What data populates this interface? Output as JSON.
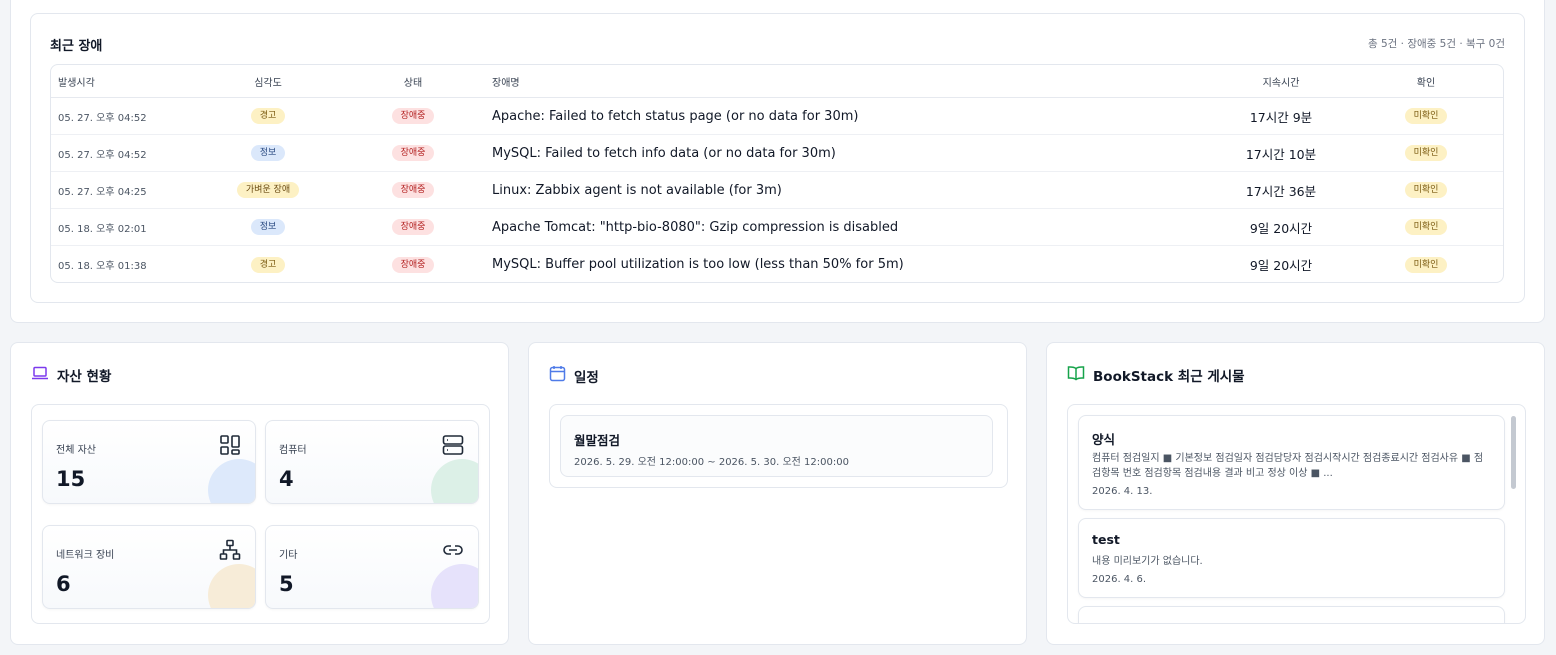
{
  "incidents": {
    "title": "최근 장애",
    "summary": "총 5건 · 장애중 5건 · 복구 0건",
    "headers": {
      "time": "발생시각",
      "severity": "심각도",
      "state": "상태",
      "name": "장애명",
      "duration": "지속시간",
      "ack": "확인"
    },
    "rows": [
      {
        "time": "05. 27. 오후 04:52",
        "severity": "경고",
        "state": "장애중",
        "name": "Apache: Failed to fetch status page (or no data for 30m)",
        "duration": "17시간 9분",
        "ack": "미확인"
      },
      {
        "time": "05. 27. 오후 04:52",
        "severity": "정보",
        "state": "장애중",
        "name": "MySQL: Failed to fetch info data (or no data for 30m)",
        "duration": "17시간 10분",
        "ack": "미확인"
      },
      {
        "time": "05. 27. 오후 04:25",
        "severity": "가벼운 장애",
        "state": "장애중",
        "name": "Linux: Zabbix agent is not available (for 3m)",
        "duration": "17시간 36분",
        "ack": "미확인"
      },
      {
        "time": "05. 18. 오후 02:01",
        "severity": "정보",
        "state": "장애중",
        "name": "Apache Tomcat: \"http-bio-8080\": Gzip compression is disabled",
        "duration": "9일 20시간",
        "ack": "미확인"
      },
      {
        "time": "05. 18. 오후 01:38",
        "severity": "경고",
        "state": "장애중",
        "name": "MySQL: Buffer pool utilization is too low (less than 50% for 5m)",
        "duration": "9일 20시간",
        "ack": "미확인"
      }
    ]
  },
  "assets": {
    "title": "자산 현황",
    "icon": "laptop-icon",
    "accent": "#7c3aed",
    "tiles": [
      {
        "label": "전체 자산",
        "count": "15",
        "icon": "grid-icon",
        "blob_color": "#dde9fb"
      },
      {
        "label": "컴퓨터",
        "count": "4",
        "icon": "server-icon",
        "blob_color": "#dcf0e7"
      },
      {
        "label": "네트워크 장비",
        "count": "6",
        "icon": "network-icon",
        "blob_color": "#f7ecd8"
      },
      {
        "label": "기타",
        "count": "5",
        "icon": "link-icon",
        "blob_color": "#e6e2fb"
      }
    ]
  },
  "schedule": {
    "title": "일정",
    "icon": "calendar-icon",
    "accent": "#4f7be8",
    "items": [
      {
        "title": "월말점검",
        "period": "2026. 5. 29. 오전 12:00:00 ~ 2026. 5. 30. 오전 12:00:00"
      }
    ]
  },
  "bookstack": {
    "title": "BookStack 최근 게시물",
    "icon": "book-open-icon",
    "accent": "#16a34a",
    "posts": [
      {
        "title": "양식",
        "preview": "컴퓨터 점검일지 ■ 기본정보 점검일자 점검담당자 점검시작시간 점검종료시간 점검사유 ■ 점검항목 번호 점검항목 점검내용 결과 비고 정상 이상 ■ ...",
        "date": "2026. 4. 13."
      },
      {
        "title": "test",
        "preview": "내용 미리보기가 없습니다.",
        "date": "2026. 4. 6."
      }
    ]
  }
}
